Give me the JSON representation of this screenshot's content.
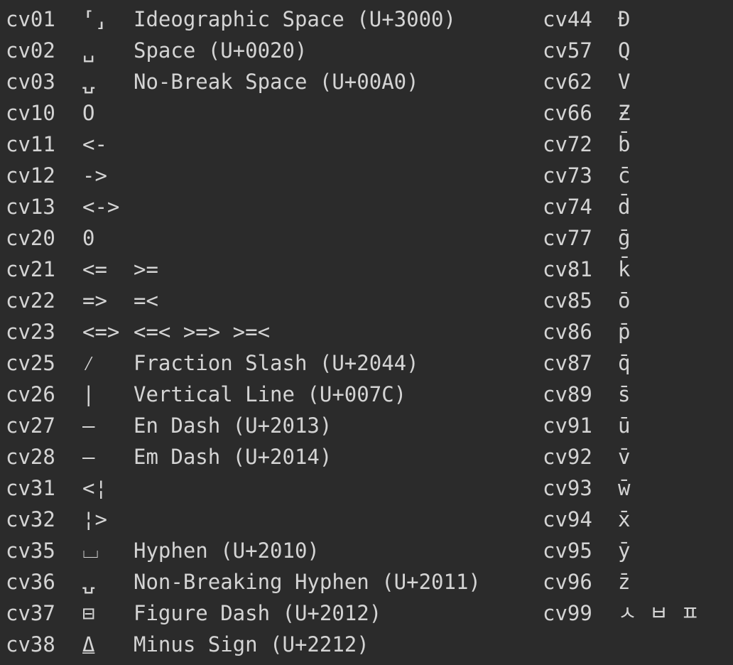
{
  "left_rows": [
    {
      "code": "cv01",
      "glyph": "⸢⸥",
      "desc": "Ideographic Space (U+3000)"
    },
    {
      "code": "cv02",
      "glyph": "␣",
      "desc": "Space (U+0020)"
    },
    {
      "code": "cv03",
      "glyph": "⍽",
      "desc": "No-Break Space (U+00A0)"
    },
    {
      "code": "cv10",
      "glyph": "O",
      "desc": ""
    },
    {
      "code": "cv11",
      "glyph": "<-",
      "desc": ""
    },
    {
      "code": "cv12",
      "glyph": "->",
      "desc": ""
    },
    {
      "code": "cv13",
      "glyph": "<->",
      "desc": ""
    },
    {
      "code": "cv20",
      "glyph": "0",
      "desc": ""
    },
    {
      "code": "cv21",
      "glyph": "<=",
      "desc": ">="
    },
    {
      "code": "cv22",
      "glyph": "=>",
      "desc": "=<"
    },
    {
      "code": "cv23",
      "glyph": "<=>",
      "desc": "<=< >=> >=<"
    },
    {
      "code": "cv25",
      "glyph": "⁄",
      "desc": "Fraction Slash (U+2044)"
    },
    {
      "code": "cv26",
      "glyph": "|",
      "desc": "Vertical Line (U+007C)"
    },
    {
      "code": "cv27",
      "glyph": "–",
      "desc": "En Dash (U+2013)"
    },
    {
      "code": "cv28",
      "glyph": "—",
      "desc": "Em Dash (U+2014)"
    },
    {
      "code": "cv31",
      "glyph": "<¦",
      "desc": ""
    },
    {
      "code": "cv32",
      "glyph": "¦>",
      "desc": ""
    },
    {
      "code": "cv35",
      "glyph": "⌴",
      "desc": "Hyphen (U+2010)"
    },
    {
      "code": "cv36",
      "glyph": "⍽",
      "desc": "Non-Breaking Hyphen (U+2011)"
    },
    {
      "code": "cv37",
      "glyph": "⊟",
      "desc": "Figure Dash (U+2012)"
    },
    {
      "code": "cv38",
      "glyph": "⍙",
      "desc": "Minus Sign (U+2212)"
    }
  ],
  "right_rows": [
    {
      "code": "cv44",
      "glyph": "Đ"
    },
    {
      "code": "cv57",
      "glyph": "Q"
    },
    {
      "code": "cv62",
      "glyph": "V"
    },
    {
      "code": "cv66",
      "glyph": "Ƶ"
    },
    {
      "code": "cv72",
      "glyph": "b̄"
    },
    {
      "code": "cv73",
      "glyph": "c̄"
    },
    {
      "code": "cv74",
      "glyph": "d̄"
    },
    {
      "code": "cv77",
      "glyph": "ḡ"
    },
    {
      "code": "cv81",
      "glyph": "k̄"
    },
    {
      "code": "cv85",
      "glyph": "ō"
    },
    {
      "code": "cv86",
      "glyph": "p̄"
    },
    {
      "code": "cv87",
      "glyph": "q̄"
    },
    {
      "code": "cv89",
      "glyph": "s̄"
    },
    {
      "code": "cv91",
      "glyph": "ū"
    },
    {
      "code": "cv92",
      "glyph": "v̄"
    },
    {
      "code": "cv93",
      "glyph": "w̄"
    },
    {
      "code": "cv94",
      "glyph": "x̄"
    },
    {
      "code": "cv95",
      "glyph": "ȳ"
    },
    {
      "code": "cv96",
      "glyph": "z̄"
    },
    {
      "code": "cv99",
      "glyph": "ㅅ ㅂ ㅍ"
    }
  ]
}
